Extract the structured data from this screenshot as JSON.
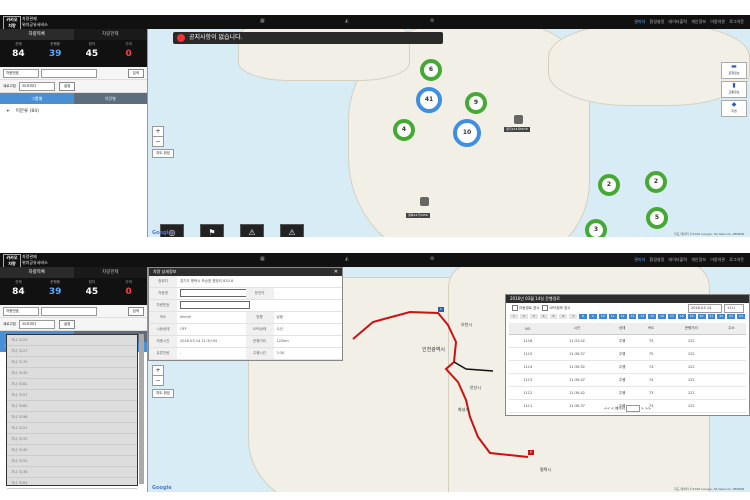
{
  "app": {
    "logo_text": "카카오 차량",
    "brand_line1": "차량관제",
    "brand_line2": "위치공유서비스",
    "top_links": [
      "관리자",
      "환경설정",
      "데이터출력",
      "개인정보",
      "이용약관",
      "로그아웃"
    ]
  },
  "sidebar": {
    "tabs": [
      "차량목록",
      "차량관제"
    ],
    "stats": [
      {
        "label": "전체",
        "value": "84",
        "color": "white"
      },
      {
        "label": "운행중",
        "value": "39",
        "color": "blue"
      },
      {
        "label": "정차",
        "value": "45",
        "color": "white"
      },
      {
        "label": "주의",
        "value": "0",
        "color": "red"
      }
    ],
    "search_select": "차량번호",
    "search_button": "검색",
    "filter_label": "새로고침",
    "filter_select": "30초마다",
    "filter_button": "설정",
    "sub_tabs": [
      "그룹별",
      "차량별"
    ],
    "tree_root": "미분류 (84)"
  },
  "screen1": {
    "notice": "공지사항이 없습니다.",
    "clusters": [
      "6",
      "41",
      "9",
      "4",
      "10",
      "2",
      "2",
      "5",
      "3"
    ],
    "pin_labels": [
      "경기123사5678",
      "경북12가3456"
    ],
    "map_type": "지도 위성",
    "right_buttons": [
      "운행정보",
      "교통정보",
      "주변"
    ],
    "google": "Google",
    "copyright": "지도 데이터 ©2016 Google, SK telecom, ZENRIN"
  },
  "screen2": {
    "dialog": {
      "title": "차량 상세정보",
      "rows": [
        [
          {
            "k": "현위치",
            "v": "경기도 평택시 포승읍 원정리 820-8"
          }
        ],
        [
          {
            "k": "차량명",
            "v": ""
          },
          {
            "k": "운전자",
            "v": "-"
          }
        ],
        [
          {
            "k": "차량번호",
            "v": ""
          }
        ],
        [
          {
            "k": "속도",
            "v": "0km/h"
          },
          {
            "k": "방향",
            "v": "남동"
          }
        ],
        [
          {
            "k": "시동상태",
            "v": "OFF"
          },
          {
            "k": "GPS상태",
            "v": "수신"
          }
        ],
        [
          {
            "k": "최종시간",
            "v": "2016-03-14 11:30:55"
          },
          {
            "k": "운행거리",
            "v": "122km"
          }
        ],
        [
          {
            "k": "유류잔량",
            "v": "-"
          },
          {
            "k": "주행시간",
            "v": "2:30"
          }
        ]
      ]
    },
    "history": {
      "title": "2016년 03월 14일 운행경로",
      "check1": "이동경로 표시",
      "check2": "GPS정보 표시",
      "date": "2016-03-14",
      "select_hour": "11시",
      "hours": [
        "1",
        "2",
        "3",
        "4",
        "5",
        "6",
        "7",
        "8",
        "9",
        "10",
        "11",
        "12",
        "13",
        "14",
        "15",
        "16",
        "17",
        "18",
        "19",
        "20",
        "21",
        "22",
        "23",
        "24"
      ],
      "active_from": 7,
      "headers": [
        "NO",
        "시간",
        "상태",
        "속도",
        "운행거리",
        "주소"
      ],
      "rows": [
        [
          "1116",
          "11:31:02",
          "주행",
          "75",
          "122",
          ""
        ],
        [
          "1115",
          "11:30:57",
          "주행",
          "75",
          "122",
          ""
        ],
        [
          "1114",
          "11:30:52",
          "주행",
          "74",
          "122",
          ""
        ],
        [
          "1113",
          "11:30:47",
          "주행",
          "74",
          "122",
          ""
        ],
        [
          "1112",
          "11:30:42",
          "주행",
          "73",
          "122",
          ""
        ],
        [
          "1111",
          "11:30:37",
          "주행",
          "74",
          "122",
          ""
        ]
      ],
      "pager_left": "<< <",
      "pager_text": "페이지",
      "pager_right": "> >>"
    },
    "list_items": [
      "가나 3123",
      "가나 3127",
      "가나 3170",
      "가나 3145",
      "가나 3182",
      "가나 3157",
      "가나 3160",
      "가나 3198",
      "가나 3121",
      "가나 3133",
      "가나 3145",
      "가나 3150",
      "가나 3138",
      "가나 3164"
    ],
    "place_names": [
      "인천광역시",
      "안산시",
      "화성시",
      "평택시",
      "부천시"
    ],
    "map_type": "지도 위성"
  }
}
